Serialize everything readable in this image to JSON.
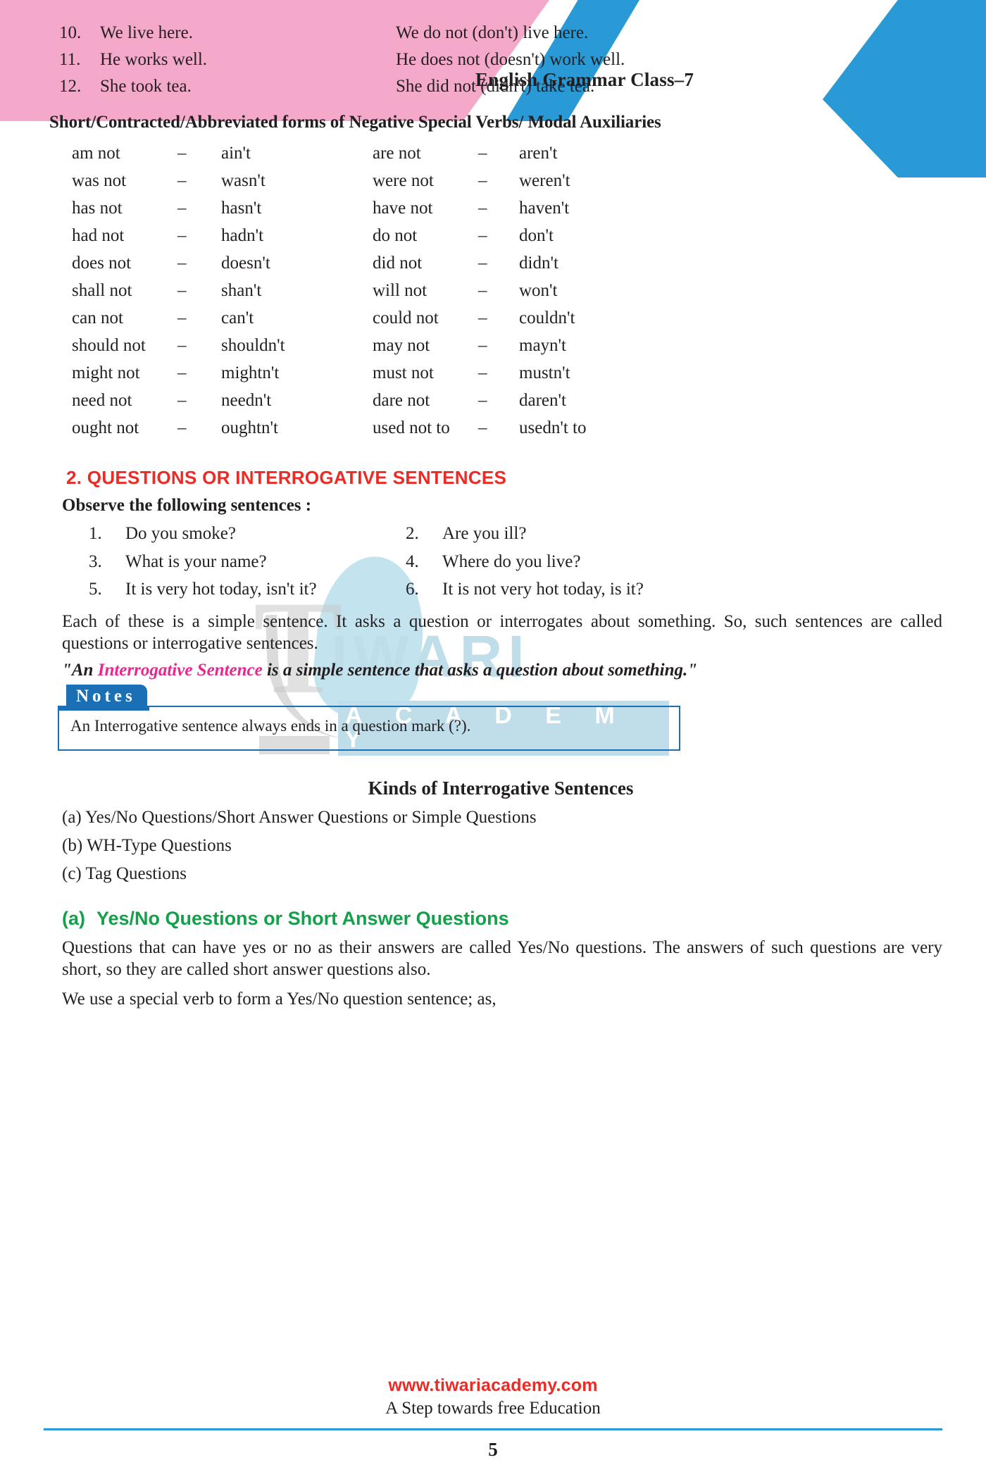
{
  "header": {
    "title": "English Grammar Class–7"
  },
  "watermark": {
    "initial": "T",
    "word": "IWARI",
    "academy": "A C A D E M Y"
  },
  "sentences": {
    "rows": [
      {
        "num": "10.",
        "positive": "We live here.",
        "negative": "We do not (don't) live here."
      },
      {
        "num": "11.",
        "positive": "He works well.",
        "negative": "He does not (doesn't) work well."
      },
      {
        "num": "12.",
        "positive": "She took tea.",
        "negative": "She did not (didn't) take tea."
      }
    ]
  },
  "contractions": {
    "heading": "Short/Contracted/Abbreviated forms of Negative Special Verbs/ Modal Auxiliaries",
    "dash": "–",
    "rows": [
      {
        "left_full": "am not",
        "left_short": "ain't",
        "right_full": "are not",
        "right_short": "aren't"
      },
      {
        "left_full": "was not",
        "left_short": "wasn't",
        "right_full": "were not",
        "right_short": "weren't"
      },
      {
        "left_full": "has not",
        "left_short": "hasn't",
        "right_full": "have not",
        "right_short": "haven't"
      },
      {
        "left_full": "had not",
        "left_short": "hadn't",
        "right_full": "do not",
        "right_short": "don't"
      },
      {
        "left_full": "does not",
        "left_short": "doesn't",
        "right_full": "did not",
        "right_short": "didn't"
      },
      {
        "left_full": "shall not",
        "left_short": "shan't",
        "right_full": "will not",
        "right_short": "won't"
      },
      {
        "left_full": "can not",
        "left_short": "can't",
        "right_full": "could not",
        "right_short": "couldn't"
      },
      {
        "left_full": "should not",
        "left_short": "shouldn't",
        "right_full": "may not",
        "right_short": "mayn't"
      },
      {
        "left_full": "might not",
        "left_short": "mightn't",
        "right_full": "must not",
        "right_short": "mustn't"
      },
      {
        "left_full": "need not",
        "left_short": "needn't",
        "right_full": "dare not",
        "right_short": "daren't"
      },
      {
        "left_full": "ought not",
        "left_short": "oughtn't",
        "right_full": "used not to",
        "right_short": "usedn't to"
      }
    ]
  },
  "section2": {
    "heading": "2. QUESTIONS OR INTERROGATIVE  SENTENCES",
    "observe": "Observe the following sentences :",
    "examples": [
      {
        "num": "1.",
        "text": "Do you smoke?"
      },
      {
        "num": "2.",
        "text": "Are you ill?"
      },
      {
        "num": "3.",
        "text": "What is your name?"
      },
      {
        "num": "4.",
        "text": "Where do you live?"
      },
      {
        "num": "5.",
        "text": "It is very hot today, isn't it?"
      },
      {
        "num": "6.",
        "text": "It is not very hot today, is it?"
      }
    ],
    "paragraph": "Each of these is a simple sentence. It asks a question or interrogates about something. So, such sentences are called questions or interrogative sentences.",
    "quote_open": "\"An ",
    "quote_pink": "Interrogative Sentence",
    "quote_rest": " is a simple sentence that asks a question about something.\""
  },
  "notes": {
    "label": "Notes",
    "text": "An Interrogative sentence always ends in a question mark (?)."
  },
  "kinds": {
    "heading": "Kinds of Interrogative Sentences",
    "items": [
      "(a) Yes/No Questions/Short Answer Questions or Simple Questions",
      "(b) WH-Type Questions",
      "(c) Tag Questions"
    ]
  },
  "yesno": {
    "label_a": "(a)",
    "heading": "Yes/No Questions or Short Answer Questions",
    "paragraph1": "Questions that can have yes or no as their answers are called Yes/No questions. The answers of such questions are very short, so they are called short answer questions also.",
    "paragraph2": "We use a special verb to form a Yes/No question sentence; as,"
  },
  "footer": {
    "url": "www.tiwariacademy.com",
    "tagline": "A Step towards free Education",
    "page_number": "5"
  },
  "colors": {
    "pink_banner": "#f4a9ca",
    "blue_accent": "#2a9ad6",
    "red_heading": "#ee2a24",
    "green_heading": "#12a04a",
    "pink_text": "#ec268f",
    "notes_blue": "#1a6fb5"
  }
}
